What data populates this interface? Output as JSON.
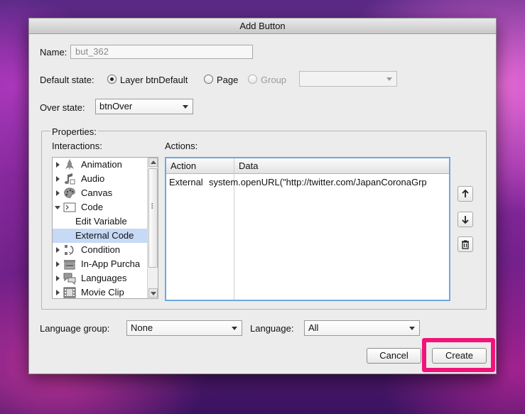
{
  "dialog": {
    "title": "Add Button"
  },
  "name": {
    "label": "Name:",
    "value": "but_362"
  },
  "default_state": {
    "label": "Default state:",
    "options": [
      {
        "label": "Layer btnDefault",
        "selected": true,
        "disabled": false
      },
      {
        "label": "Page",
        "selected": false,
        "disabled": false
      },
      {
        "label": "Group",
        "selected": false,
        "disabled": true
      }
    ],
    "group_select_value": ""
  },
  "over_state": {
    "label": "Over state:",
    "value": "btnOver"
  },
  "properties": {
    "legend": "Properties:",
    "interactions_label": "Interactions:",
    "actions_label": "Actions:",
    "interactions": [
      {
        "label": "Animation",
        "icon": "rocket-icon",
        "expanded": false,
        "child": false,
        "selected": false
      },
      {
        "label": "Audio",
        "icon": "music-note-icon",
        "expanded": false,
        "child": false,
        "selected": false
      },
      {
        "label": "Canvas",
        "icon": "palette-icon",
        "expanded": false,
        "child": false,
        "selected": false
      },
      {
        "label": "Code",
        "icon": "terminal-icon",
        "expanded": true,
        "child": false,
        "selected": false
      },
      {
        "label": "Edit Variable",
        "icon": "",
        "expanded": false,
        "child": true,
        "selected": false
      },
      {
        "label": "External Code",
        "icon": "",
        "expanded": false,
        "child": true,
        "selected": true
      },
      {
        "label": "Condition",
        "icon": "condition-icon",
        "expanded": false,
        "child": false,
        "selected": false
      },
      {
        "label": "In-App Purcha",
        "icon": "cash-register-icon",
        "expanded": false,
        "child": false,
        "selected": false
      },
      {
        "label": "Languages",
        "icon": "speech-bubbles-icon",
        "expanded": false,
        "child": false,
        "selected": false
      },
      {
        "label": "Movie Clip",
        "icon": "film-icon",
        "expanded": false,
        "child": false,
        "selected": false
      }
    ],
    "actions_table": {
      "columns": [
        "Action",
        "Data"
      ],
      "rows": [
        {
          "action": "External",
          "data": "system.openURL(\"http://twitter.com/JapanCoronaGrp"
        }
      ]
    }
  },
  "language_group": {
    "label": "Language group:",
    "value": "None"
  },
  "language": {
    "label": "Language:",
    "value": "All"
  },
  "buttons": {
    "cancel": "Cancel",
    "create": "Create"
  },
  "colors": {
    "highlight": "#f0147a",
    "selection": "#c6d9f5",
    "table_focus": "#6fa7e0"
  }
}
